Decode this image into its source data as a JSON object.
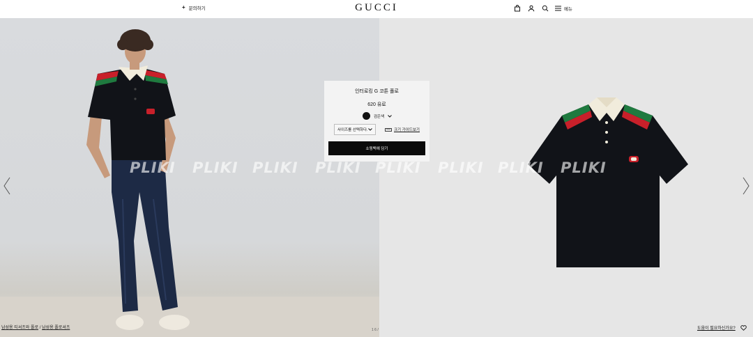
{
  "header": {
    "contact_label": "문의하기",
    "logo": "GUCCI",
    "menu_label": "메뉴",
    "icons": [
      "shopping-bag-icon",
      "user-icon",
      "search-icon",
      "menu-icon"
    ]
  },
  "watermark": {
    "text": "PLIKI"
  },
  "product": {
    "name": "인터로킹 G 코튼 폴로",
    "price": "620 유로",
    "color_label": "검은색",
    "color_hex": "#111111",
    "size_placeholder": "사이즈를 선택하다.",
    "size_guide_label": "크기 가이드보기",
    "cart_button": "쇼핑백에 담기"
  },
  "gallery": {
    "pager": "1 6 /"
  },
  "breadcrumb": {
    "items": [
      "남성용 티셔츠와 폴로",
      "남성용 폴로셔츠"
    ],
    "separator": "/"
  },
  "help": {
    "label": "도움이 필요하신가요?"
  },
  "colors": {
    "stripe_green": "#1f7a3f",
    "stripe_red": "#c8202a",
    "shirt_black": "#111318",
    "collar_cream": "#f1ecdc",
    "jeans_blue": "#1d2a45"
  }
}
